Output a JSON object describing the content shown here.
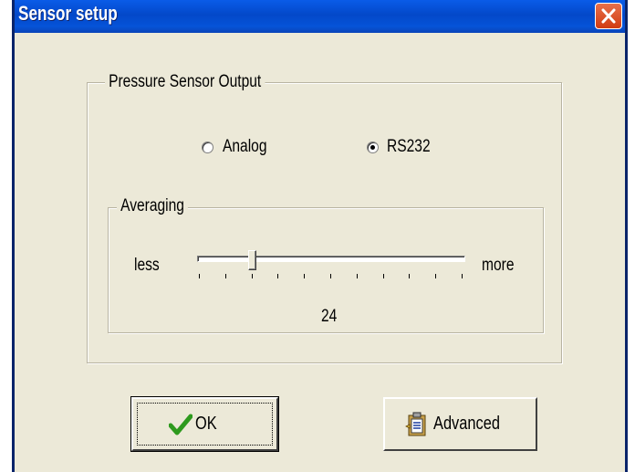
{
  "window": {
    "title": "Sensor setup",
    "close_icon": "close-icon"
  },
  "output_group": {
    "legend": "Pressure Sensor Output",
    "options": [
      {
        "label": "Analog",
        "selected": false
      },
      {
        "label": "RS232",
        "selected": true
      }
    ]
  },
  "averaging_group": {
    "legend": "Averaging",
    "min_label": "less",
    "max_label": "more",
    "value_text": "24",
    "slider_fraction": 0.2,
    "tick_count": 11
  },
  "buttons": {
    "ok_label": "OK",
    "ok_icon": "checkmark-icon",
    "advanced_label": "Advanced",
    "advanced_icon": "clipboard-icon"
  },
  "colors": {
    "titlebar": "#0348c9",
    "dialog_face": "#ece9d8",
    "close_button": "#d13c13",
    "checkmark": "#2e9a1e"
  }
}
